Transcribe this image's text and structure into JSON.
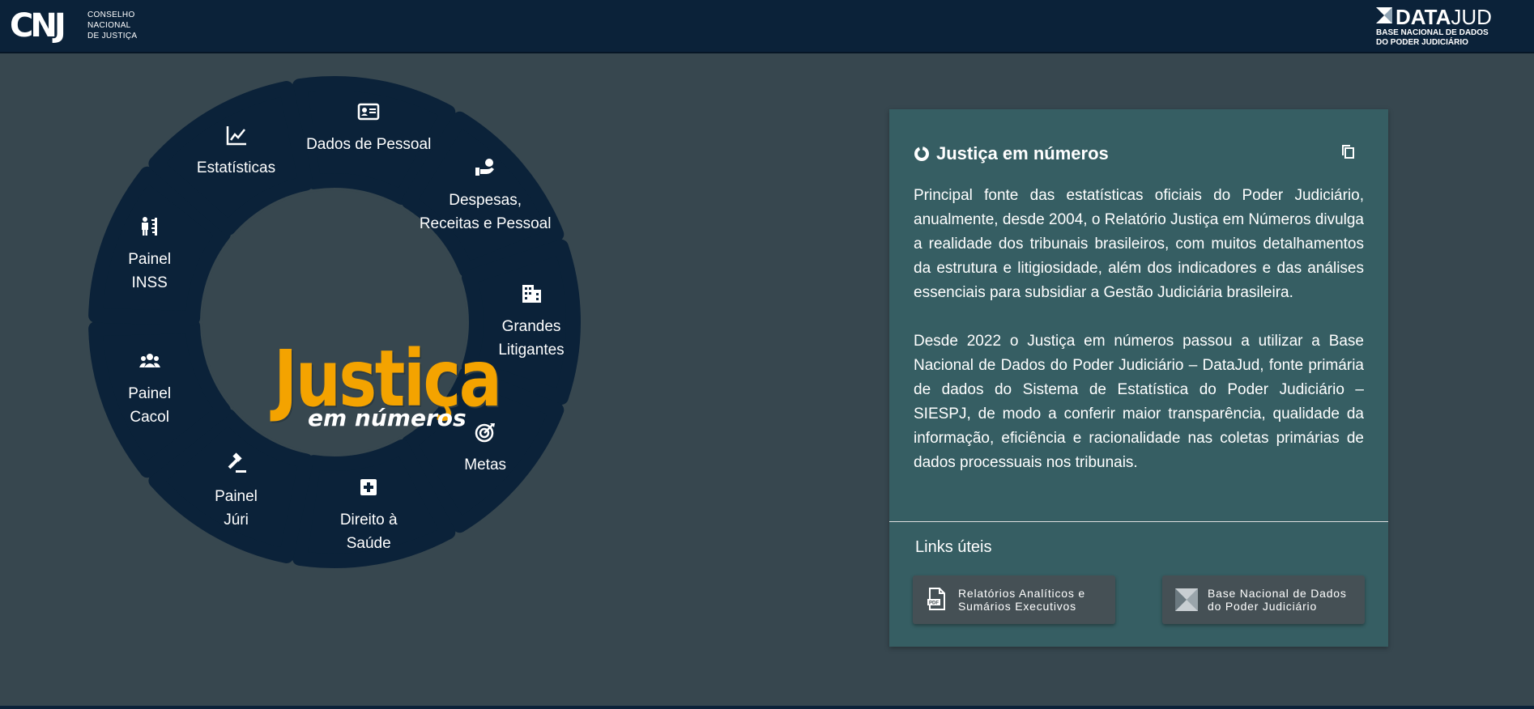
{
  "header": {
    "logo_mark": "CNJ",
    "org_lines": [
      "CONSELHO",
      "NACIONAL",
      "DE JUSTIÇA"
    ],
    "datajud_bold": "DATA",
    "datajud_light": "JUD",
    "datajud_sub": [
      "BASE NACIONAL DE DADOS",
      "DO PODER JUDICIÁRIO"
    ]
  },
  "wheel": {
    "center_logo_big": "Justiça",
    "center_logo_small": "em números",
    "segments": [
      {
        "label_lines": [
          "Dados de Pessoal"
        ],
        "icon": "id-card-icon"
      },
      {
        "label_lines": [
          "Despesas,",
          "Receitas e Pessoal"
        ],
        "icon": "hand-money-icon"
      },
      {
        "label_lines": [
          "Grandes",
          "Litigantes"
        ],
        "icon": "building-icon"
      },
      {
        "label_lines": [
          "Metas"
        ],
        "icon": "target-icon"
      },
      {
        "label_lines": [
          "Direito à",
          "Saúde"
        ],
        "icon": "medical-plus-icon"
      },
      {
        "label_lines": [
          "Painel",
          "Júri"
        ],
        "icon": "gavel-icon"
      },
      {
        "label_lines": [
          "Painel",
          "Cacol"
        ],
        "icon": "group-icon"
      },
      {
        "label_lines": [
          "Painel",
          "INSS"
        ],
        "icon": "person-height-icon"
      },
      {
        "label_lines": [
          "Estatísticas"
        ],
        "icon": "line-chart-icon"
      }
    ]
  },
  "card": {
    "title": "Justiça em números",
    "paragraphs": [
      "Principal fonte das estatísticas oficiais do Poder Judiciário, anualmente, desde 2004, o Relatório Justiça em Números divulga a realidade dos tribunais brasileiros, com muitos detalhamentos da estrutura e litigiosidade, além dos indicadores e das análises essenciais para subsidiar a Gestão Judiciária brasileira.",
      "Desde 2022 o Justiça em números passou a utilizar a Base Nacional de Dados do Poder Judiciário – DataJud, fonte primária de dados do Sistema de Estatística do Poder Judiciário – SIESPJ, de modo a conferir maior transparência, qualidade da informação, eficiência e racionalidade nas coletas primárias de dados processuais nos tribunais."
    ],
    "links_title": "Links úteis",
    "links": [
      {
        "label": "Relatórios Analíticos e Sumários Executivos",
        "icon": "pdf-icon"
      },
      {
        "label": "Base Nacional de Dados do Poder Judiciário",
        "icon": "datajud-icon"
      }
    ]
  },
  "colors": {
    "background": "#37474f",
    "topbar": "#0b2239",
    "segment": "#0b2239",
    "card": "#365e63",
    "logo_orange": "#f4a300"
  }
}
